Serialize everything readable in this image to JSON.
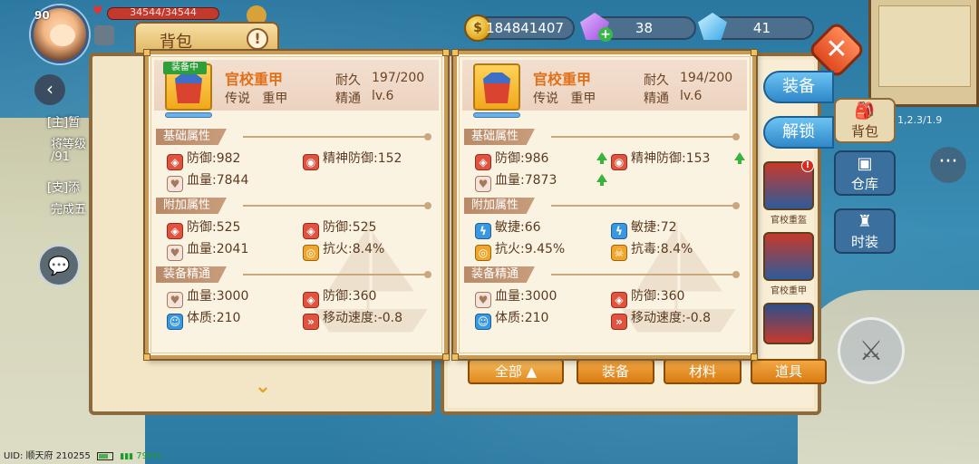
{
  "player": {
    "level": "90",
    "hp_text": "34544/34544"
  },
  "bag_tab": {
    "label": "背包",
    "hint": "!"
  },
  "currencies": {
    "gold": "184841407",
    "purple_gems": "38",
    "blue_gems": "41"
  },
  "quests": {
    "main": "[主]暂",
    "main_detail_1": "将等级",
    "main_detail_2": "/91",
    "side": "[支]添",
    "side_detail": "完成五"
  },
  "coords": "1,2.3/1.9",
  "compare_left": {
    "equipped_badge": "装备中",
    "name": "官校重甲",
    "quality": "传说",
    "type": "重甲",
    "durability_label": "耐久",
    "durability": "197/200",
    "mastery_label": "精通",
    "mastery": "lv.6",
    "sections": {
      "base": "基础属性",
      "extra": "附加属性",
      "mastery": "装备精通"
    },
    "base": [
      "防御:982",
      "精神防御:152",
      "血量:7844"
    ],
    "extra": [
      "防御:525",
      "防御:525",
      "血量:2041",
      "抗火:8.4%"
    ],
    "mastery_stats": [
      "血量:3000",
      "防御:360",
      "体质:210",
      "移动速度:-0.8"
    ]
  },
  "compare_right": {
    "name": "官校重甲",
    "quality": "传说",
    "type": "重甲",
    "durability_label": "耐久",
    "durability": "194/200",
    "mastery_label": "精通",
    "mastery": "lv.6",
    "sections": {
      "base": "基础属性",
      "extra": "附加属性",
      "mastery": "装备精通"
    },
    "base": [
      "防御:986",
      "精神防御:153",
      "血量:7873"
    ],
    "extra": [
      "敏捷:66",
      "敏捷:72",
      "抗火:9.45%",
      "抗毒:8.4%"
    ],
    "mastery_stats": [
      "血量:3000",
      "防御:360",
      "体质:210",
      "移动速度:-0.8"
    ]
  },
  "actions": {
    "equip": "装备",
    "unlock": "解锁"
  },
  "side_tabs": {
    "bag": "背包",
    "warehouse": "仓库",
    "fashion": "时装"
  },
  "bag_items": [
    {
      "label": "官校重盔"
    },
    {
      "label": "官校重甲"
    }
  ],
  "bottom_tabs": {
    "all": "全部",
    "equipment": "装备",
    "materials": "材料",
    "props": "道具"
  },
  "status_bar": {
    "uid": "UID: 顺天府 210255",
    "latency": "79ms"
  },
  "colors": {
    "gold_name": "#e0701a",
    "stat_up": "#37b33e",
    "equipped_badge": "#2f9f3a",
    "side_button": "#2f88c9"
  }
}
